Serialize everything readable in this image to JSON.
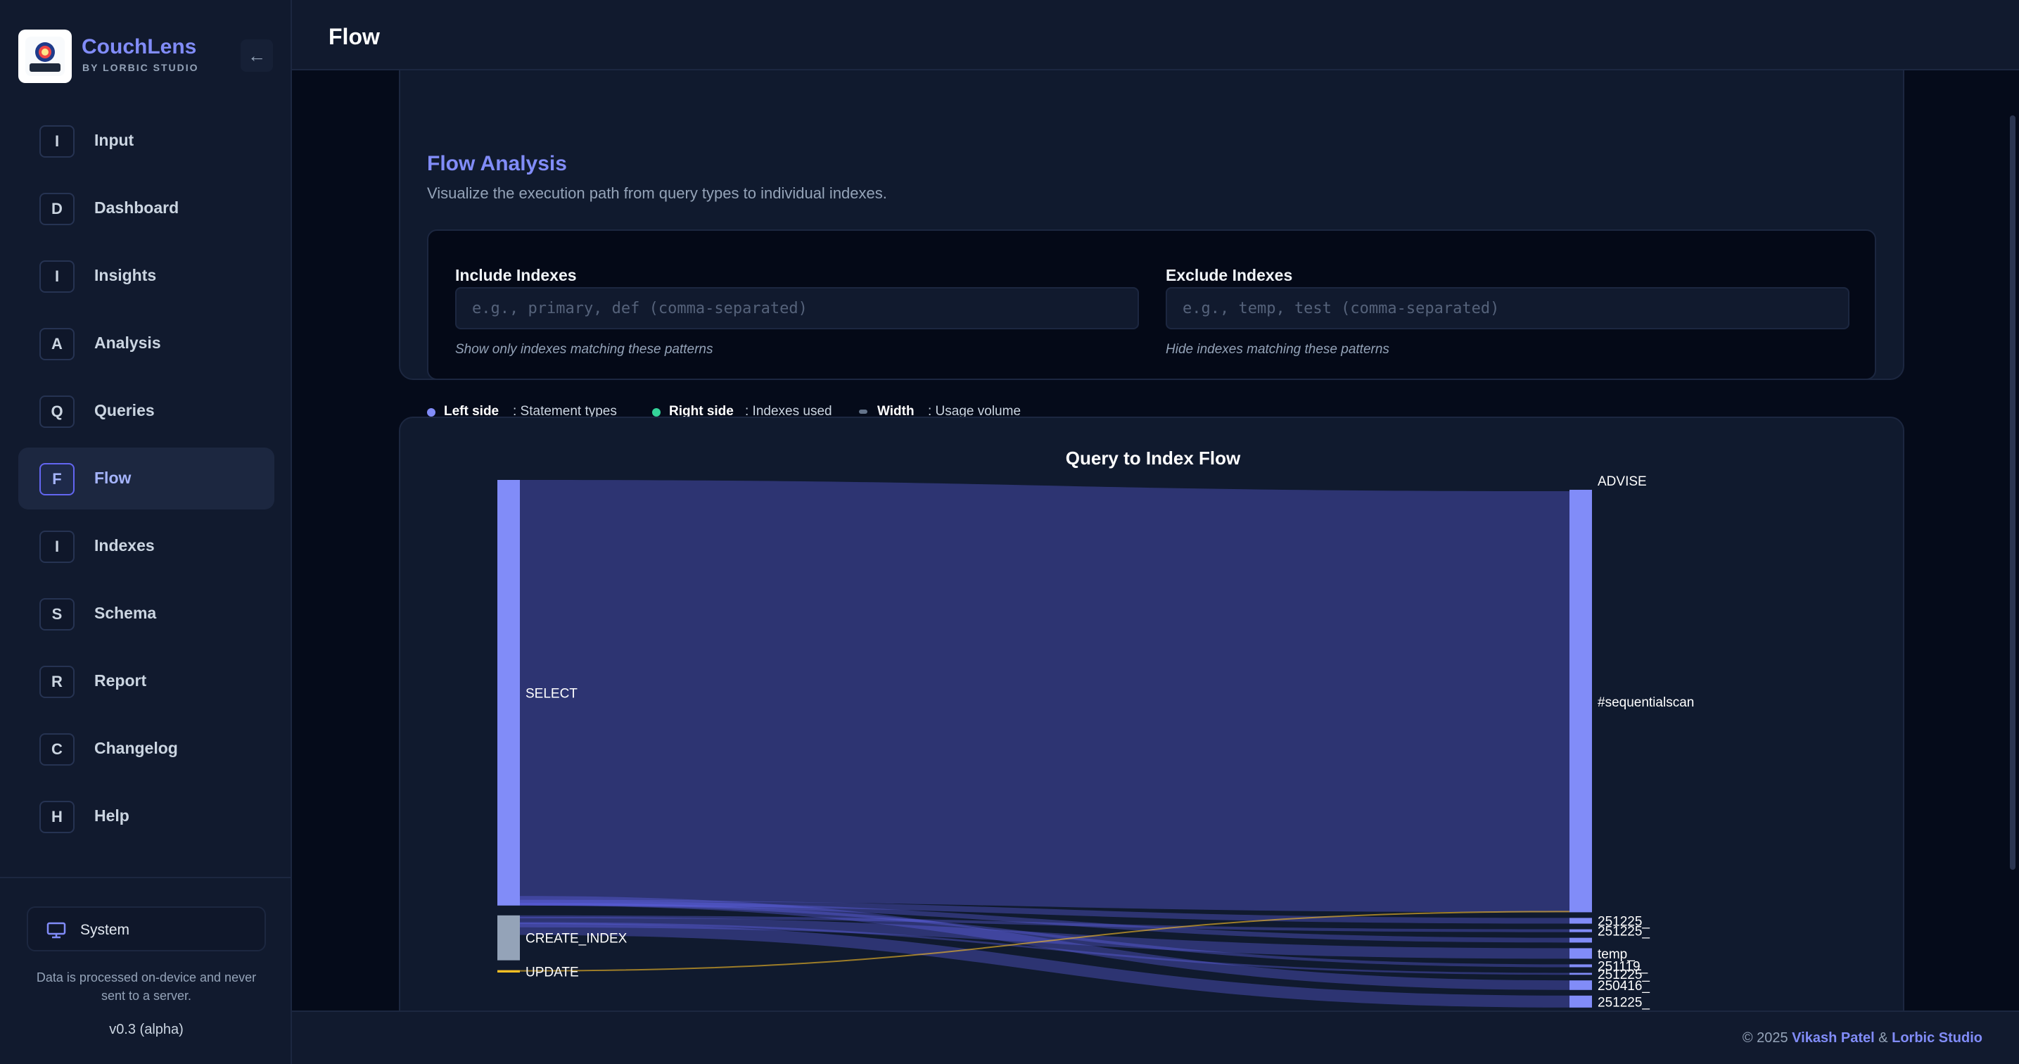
{
  "brand": {
    "name": "CouchLens",
    "sub": "BY LORBIC STUDIO",
    "logo_text": "CouchLens"
  },
  "collapse_icon": "←",
  "nav": [
    {
      "badge": "I",
      "label": "Input"
    },
    {
      "badge": "D",
      "label": "Dashboard"
    },
    {
      "badge": "I",
      "label": "Insights"
    },
    {
      "badge": "A",
      "label": "Analysis"
    },
    {
      "badge": "Q",
      "label": "Queries"
    },
    {
      "badge": "F",
      "label": "Flow",
      "active": true
    },
    {
      "badge": "I",
      "label": "Indexes"
    },
    {
      "badge": "S",
      "label": "Schema"
    },
    {
      "badge": "R",
      "label": "Report"
    },
    {
      "badge": "C",
      "label": "Changelog"
    },
    {
      "badge": "H",
      "label": "Help"
    }
  ],
  "sidebar_footer": {
    "system_label": "System",
    "system_icon": "monitor-icon",
    "privacy": "Data is processed on-device and never sent to a server.",
    "version": "v0.3 (alpha)"
  },
  "header": {
    "title": "Flow"
  },
  "flow_analysis": {
    "title": "Flow Analysis",
    "description": "Visualize the execution path from query types to individual indexes.",
    "include": {
      "label": "Include Indexes",
      "placeholder": "e.g., primary, def (comma-separated)",
      "hint": "Show only indexes matching these patterns",
      "value": ""
    },
    "exclude": {
      "label": "Exclude Indexes",
      "placeholder": "e.g., temp, test (comma-separated)",
      "hint": "Hide indexes matching these patterns",
      "value": ""
    },
    "legend": [
      {
        "key": "Left side",
        "desc": ": Statement types",
        "color": "#818cf8"
      },
      {
        "key": "Right side",
        "desc": ": Indexes used",
        "color": "#34d399"
      },
      {
        "key": "Width",
        "desc": ": Usage volume",
        "color": "#64748b"
      }
    ]
  },
  "chart_data": {
    "type": "sankey",
    "title": "Query to Index Flow",
    "left_nodes": [
      {
        "name": "SELECT",
        "share": 0.9,
        "color": "#818cf8"
      },
      {
        "name": "CREATE_INDEX",
        "share": 0.095,
        "color": "#94a3b8"
      },
      {
        "name": "UPDATE",
        "share": 0.005,
        "color": "#fbbf24"
      }
    ],
    "right_nodes": [
      {
        "name": "ADVISE",
        "share": 0.0
      },
      {
        "name": "#sequentialscan",
        "share": 0.88
      },
      {
        "name": "251225_",
        "share": 0.012
      },
      {
        "name": "251225_",
        "share": 0.006
      },
      {
        "name": "",
        "share": 0.01
      },
      {
        "name": "temp_",
        "share": 0.022
      },
      {
        "name": "251119_",
        "share": 0.006
      },
      {
        "name": "251225_",
        "share": 0.004
      },
      {
        "name": "250416_",
        "share": 0.02
      },
      {
        "name": "251225_",
        "share": 0.025
      }
    ],
    "node_color": "#818cf8",
    "link_color": "#6366f1"
  },
  "footer": {
    "prefix": "© 2025 ",
    "author": "Vikash Patel",
    "sep": " & ",
    "studio": "Lorbic Studio"
  }
}
